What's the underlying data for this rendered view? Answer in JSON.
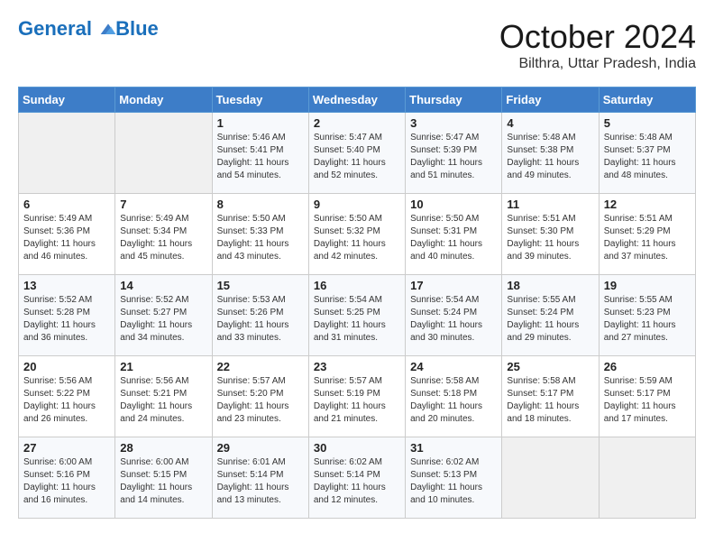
{
  "header": {
    "logo_line1": "General",
    "logo_line2": "Blue",
    "month": "October 2024",
    "location": "Bilthra, Uttar Pradesh, India"
  },
  "weekdays": [
    "Sunday",
    "Monday",
    "Tuesday",
    "Wednesday",
    "Thursday",
    "Friday",
    "Saturday"
  ],
  "weeks": [
    [
      {
        "day": "",
        "info": ""
      },
      {
        "day": "",
        "info": ""
      },
      {
        "day": "1",
        "info": "Sunrise: 5:46 AM\nSunset: 5:41 PM\nDaylight: 11 hours and 54 minutes."
      },
      {
        "day": "2",
        "info": "Sunrise: 5:47 AM\nSunset: 5:40 PM\nDaylight: 11 hours and 52 minutes."
      },
      {
        "day": "3",
        "info": "Sunrise: 5:47 AM\nSunset: 5:39 PM\nDaylight: 11 hours and 51 minutes."
      },
      {
        "day": "4",
        "info": "Sunrise: 5:48 AM\nSunset: 5:38 PM\nDaylight: 11 hours and 49 minutes."
      },
      {
        "day": "5",
        "info": "Sunrise: 5:48 AM\nSunset: 5:37 PM\nDaylight: 11 hours and 48 minutes."
      }
    ],
    [
      {
        "day": "6",
        "info": "Sunrise: 5:49 AM\nSunset: 5:36 PM\nDaylight: 11 hours and 46 minutes."
      },
      {
        "day": "7",
        "info": "Sunrise: 5:49 AM\nSunset: 5:34 PM\nDaylight: 11 hours and 45 minutes."
      },
      {
        "day": "8",
        "info": "Sunrise: 5:50 AM\nSunset: 5:33 PM\nDaylight: 11 hours and 43 minutes."
      },
      {
        "day": "9",
        "info": "Sunrise: 5:50 AM\nSunset: 5:32 PM\nDaylight: 11 hours and 42 minutes."
      },
      {
        "day": "10",
        "info": "Sunrise: 5:50 AM\nSunset: 5:31 PM\nDaylight: 11 hours and 40 minutes."
      },
      {
        "day": "11",
        "info": "Sunrise: 5:51 AM\nSunset: 5:30 PM\nDaylight: 11 hours and 39 minutes."
      },
      {
        "day": "12",
        "info": "Sunrise: 5:51 AM\nSunset: 5:29 PM\nDaylight: 11 hours and 37 minutes."
      }
    ],
    [
      {
        "day": "13",
        "info": "Sunrise: 5:52 AM\nSunset: 5:28 PM\nDaylight: 11 hours and 36 minutes."
      },
      {
        "day": "14",
        "info": "Sunrise: 5:52 AM\nSunset: 5:27 PM\nDaylight: 11 hours and 34 minutes."
      },
      {
        "day": "15",
        "info": "Sunrise: 5:53 AM\nSunset: 5:26 PM\nDaylight: 11 hours and 33 minutes."
      },
      {
        "day": "16",
        "info": "Sunrise: 5:54 AM\nSunset: 5:25 PM\nDaylight: 11 hours and 31 minutes."
      },
      {
        "day": "17",
        "info": "Sunrise: 5:54 AM\nSunset: 5:24 PM\nDaylight: 11 hours and 30 minutes."
      },
      {
        "day": "18",
        "info": "Sunrise: 5:55 AM\nSunset: 5:24 PM\nDaylight: 11 hours and 29 minutes."
      },
      {
        "day": "19",
        "info": "Sunrise: 5:55 AM\nSunset: 5:23 PM\nDaylight: 11 hours and 27 minutes."
      }
    ],
    [
      {
        "day": "20",
        "info": "Sunrise: 5:56 AM\nSunset: 5:22 PM\nDaylight: 11 hours and 26 minutes."
      },
      {
        "day": "21",
        "info": "Sunrise: 5:56 AM\nSunset: 5:21 PM\nDaylight: 11 hours and 24 minutes."
      },
      {
        "day": "22",
        "info": "Sunrise: 5:57 AM\nSunset: 5:20 PM\nDaylight: 11 hours and 23 minutes."
      },
      {
        "day": "23",
        "info": "Sunrise: 5:57 AM\nSunset: 5:19 PM\nDaylight: 11 hours and 21 minutes."
      },
      {
        "day": "24",
        "info": "Sunrise: 5:58 AM\nSunset: 5:18 PM\nDaylight: 11 hours and 20 minutes."
      },
      {
        "day": "25",
        "info": "Sunrise: 5:58 AM\nSunset: 5:17 PM\nDaylight: 11 hours and 18 minutes."
      },
      {
        "day": "26",
        "info": "Sunrise: 5:59 AM\nSunset: 5:17 PM\nDaylight: 11 hours and 17 minutes."
      }
    ],
    [
      {
        "day": "27",
        "info": "Sunrise: 6:00 AM\nSunset: 5:16 PM\nDaylight: 11 hours and 16 minutes."
      },
      {
        "day": "28",
        "info": "Sunrise: 6:00 AM\nSunset: 5:15 PM\nDaylight: 11 hours and 14 minutes."
      },
      {
        "day": "29",
        "info": "Sunrise: 6:01 AM\nSunset: 5:14 PM\nDaylight: 11 hours and 13 minutes."
      },
      {
        "day": "30",
        "info": "Sunrise: 6:02 AM\nSunset: 5:14 PM\nDaylight: 11 hours and 12 minutes."
      },
      {
        "day": "31",
        "info": "Sunrise: 6:02 AM\nSunset: 5:13 PM\nDaylight: 11 hours and 10 minutes."
      },
      {
        "day": "",
        "info": ""
      },
      {
        "day": "",
        "info": ""
      }
    ]
  ]
}
